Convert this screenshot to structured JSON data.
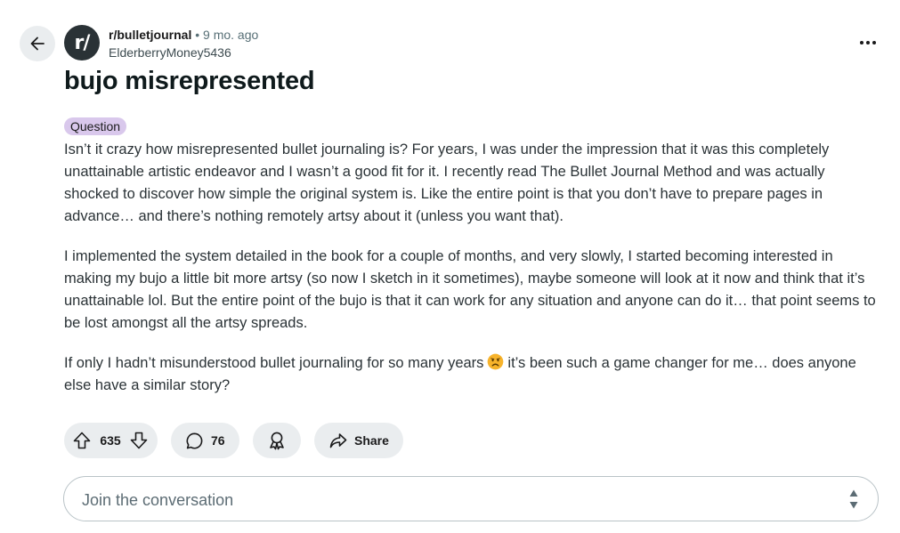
{
  "header": {
    "back_icon": "arrow-left-icon",
    "subreddit_avatar_text": "r/",
    "subreddit": "r/bulletjournal",
    "separator": "•",
    "time_ago": "9 mo. ago",
    "username": "ElderberryMoney5436",
    "more_icon": "ellipsis-icon"
  },
  "post": {
    "title": "bujo misrepresented",
    "flair": "Question",
    "flair_color": "#d9c8ec",
    "paragraphs": [
      "Isn’t it crazy how misrepresented bullet journaling is? For years, I was under the impression that it was this completely unattainable artistic endeavor and I wasn’t a good fit for it. I recently read The Bullet Journal Method and was actually shocked to discover how simple the original system is. Like the entire point is that you don’t have to prepare pages in advance… and there’s nothing remotely artsy about it (unless you want that).",
      "I implemented the system detailed in the book for a couple of months, and very slowly, I started becoming interested in making my bujo a little bit more artsy (so now I sketch in it sometimes), maybe someone will look at it now and think that it’s unattainable lol. But the entire point of the bujo is that it can work for any situation and anyone can do it… that point seems to be lost amongst all the artsy spreads."
    ],
    "last_paragraph_before": "If only I hadn’t misunderstood bullet journaling for so many years",
    "last_paragraph_emoji": "frowning-face-emoji",
    "last_paragraph_after": "it’s been such a game changer for me… does anyone else have a similar story?"
  },
  "actions": {
    "upvote_icon": "upvote-arrow-icon",
    "score": "635",
    "downvote_icon": "downvote-arrow-icon",
    "comment_icon": "speech-bubble-icon",
    "comment_count": "76",
    "award_icon": "award-ribbon-icon",
    "share_icon": "share-arrow-icon",
    "share_label": "Share"
  },
  "comment_box": {
    "placeholder": "Join the conversation",
    "sort_icon": "up-down-chevron-icon"
  },
  "colors": {
    "pill_background": "#eaedef",
    "avatar_background": "#2a3236",
    "emoji_yellow": "#f7b32b"
  }
}
